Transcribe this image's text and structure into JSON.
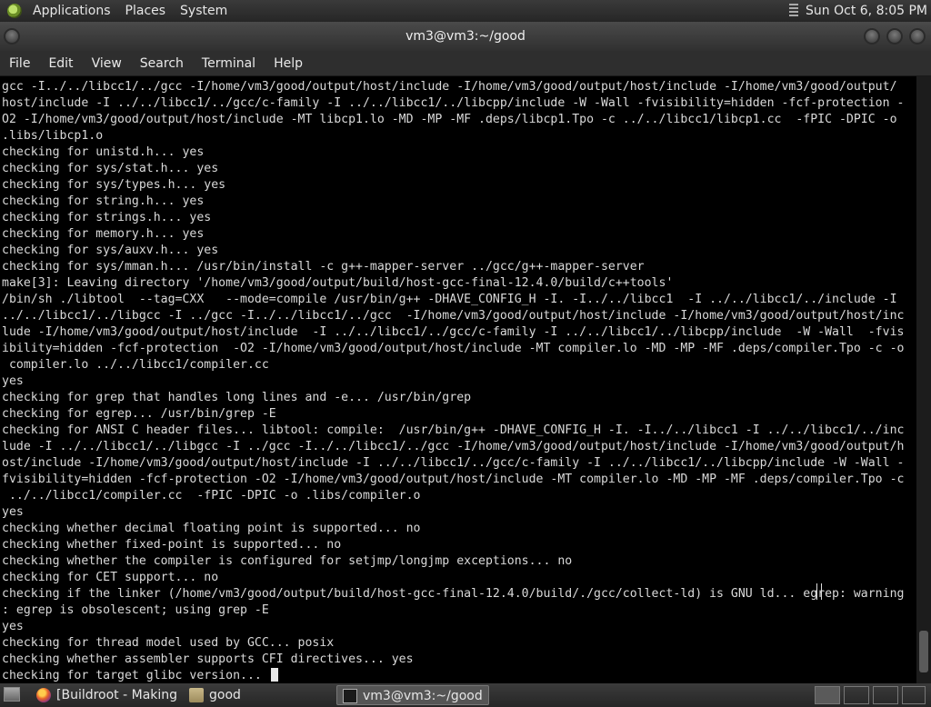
{
  "top_panel": {
    "menus": [
      "Applications",
      "Places",
      "System"
    ],
    "clock": "Sun Oct  6,  8:05 PM"
  },
  "window": {
    "title": "vm3@vm3:~/good"
  },
  "menubar": [
    "File",
    "Edit",
    "View",
    "Search",
    "Terminal",
    "Help"
  ],
  "terminal": {
    "lines": [
      "gcc -I../../libcc1/../gcc -I/home/vm3/good/output/host/include -I/home/vm3/good/output/host/include -I/home/vm3/good/output/",
      "host/include -I ../../libcc1/../gcc/c-family -I ../../libcc1/../libcpp/include -W -Wall -fvisibility=hidden -fcf-protection -",
      "O2 -I/home/vm3/good/output/host/include -MT libcp1.lo -MD -MP -MF .deps/libcp1.Tpo -c ../../libcc1/libcp1.cc  -fPIC -DPIC -o",
      ".libs/libcp1.o",
      "checking for unistd.h... yes",
      "checking for sys/stat.h... yes",
      "checking for sys/types.h... yes",
      "checking for string.h... yes",
      "checking for strings.h... yes",
      "checking for memory.h... yes",
      "checking for sys/auxv.h... yes",
      "checking for sys/mman.h... /usr/bin/install -c g++-mapper-server ../gcc/g++-mapper-server",
      "make[3]: Leaving directory '/home/vm3/good/output/build/host-gcc-final-12.4.0/build/c++tools'",
      "/bin/sh ./libtool  --tag=CXX   --mode=compile /usr/bin/g++ -DHAVE_CONFIG_H -I. -I../../libcc1  -I ../../libcc1/../include -I",
      "../../libcc1/../libgcc -I ../gcc -I../../libcc1/../gcc  -I/home/vm3/good/output/host/include -I/home/vm3/good/output/host/inc",
      "lude -I/home/vm3/good/output/host/include  -I ../../libcc1/../gcc/c-family -I ../../libcc1/../libcpp/include  -W -Wall  -fvis",
      "ibility=hidden -fcf-protection  -O2 -I/home/vm3/good/output/host/include -MT compiler.lo -MD -MP -MF .deps/compiler.Tpo -c -o",
      " compiler.lo ../../libcc1/compiler.cc",
      "yes",
      "checking for grep that handles long lines and -e... /usr/bin/grep",
      "checking for egrep... /usr/bin/grep -E",
      "checking for ANSI C header files... libtool: compile:  /usr/bin/g++ -DHAVE_CONFIG_H -I. -I../../libcc1 -I ../../libcc1/../inc",
      "lude -I ../../libcc1/../libgcc -I ../gcc -I../../libcc1/../gcc -I/home/vm3/good/output/host/include -I/home/vm3/good/output/h",
      "ost/include -I/home/vm3/good/output/host/include -I ../../libcc1/../gcc/c-family -I ../../libcc1/../libcpp/include -W -Wall -",
      "fvisibility=hidden -fcf-protection -O2 -I/home/vm3/good/output/host/include -MT compiler.lo -MD -MP -MF .deps/compiler.Tpo -c",
      " ../../libcc1/compiler.cc  -fPIC -DPIC -o .libs/compiler.o",
      "yes",
      "checking whether decimal floating point is supported... no",
      "checking whether fixed-point is supported... no",
      "checking whether the compiler is configured for setjmp/longjmp exceptions... no",
      "checking for CET support... no",
      "checking if the linker (/home/vm3/good/output/build/host-gcc-final-12.4.0/build/./gcc/collect-ld) is GNU ld... egrep: warning",
      ": egrep is obsolescent; using grep -E",
      "yes",
      "checking for thread model used by GCC... posix",
      "checking whether assembler supports CFI directives... yes",
      "checking for target glibc version... "
    ]
  },
  "taskbar": {
    "tasks": [
      "[Buildroot - Making ...",
      "good",
      "vm3@vm3:~/good"
    ]
  }
}
